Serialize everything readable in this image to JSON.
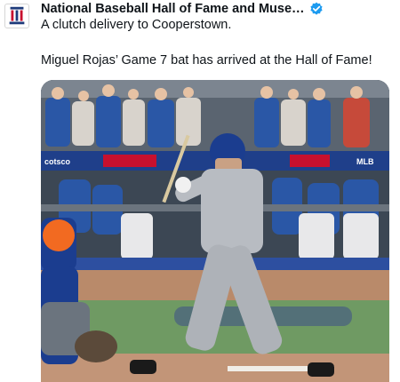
{
  "account": {
    "display_name": "National Baseball Hall of Fame and Muse…",
    "verified": true,
    "avatar_icon": "hall-of-fame-logo-icon",
    "verified_icon": "verified-badge-icon"
  },
  "post": {
    "line1": "A clutch delivery to Cooperstown.",
    "line2": "Miguel Rojas’ Game 7 bat has arrived at the Hall of Fame!"
  },
  "media": {
    "type": "video-still",
    "description_icon": "baseball-batter-image",
    "colors": {
      "crowd_blue": "#2a57a6",
      "field_green": "#6f9a63",
      "dirt": "#b98a6a",
      "uniform_gray": "#b8bcc2",
      "helmet_blue": "#1b3d8f"
    }
  }
}
